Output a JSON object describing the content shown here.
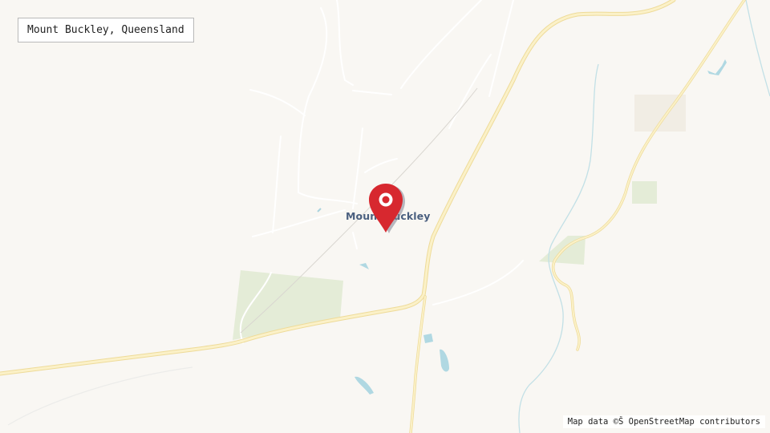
{
  "map": {
    "title": "Mount Buckley, Queensland",
    "place_label": "Mount Buckley",
    "attribution": "Map data ©Š OpenStreetMap contributors",
    "marker_icon": "map-pin-icon",
    "colors": {
      "background": "#f9f7f3",
      "road_major": "#f6e3a1",
      "road_minor": "#ffffff",
      "vegetation": "#e3ecd6",
      "water": "#a9d3de",
      "marker": "#d7282f"
    }
  }
}
